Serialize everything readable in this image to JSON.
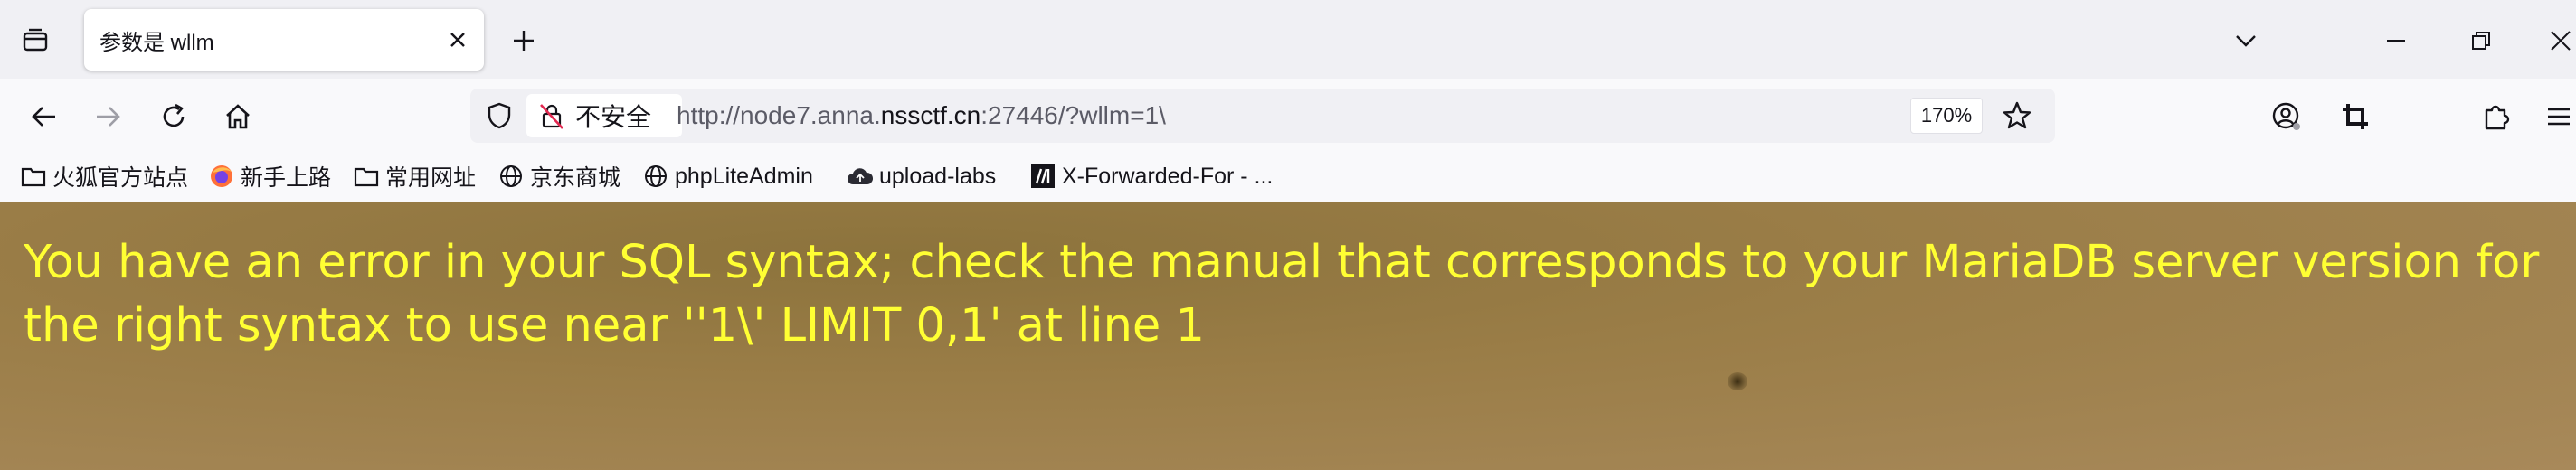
{
  "tab": {
    "title": "参数是 wllm"
  },
  "toolbar": {
    "security_label": "不安全",
    "url_prefix": "http://node7.anna.",
    "url_host": "nssctf.cn",
    "url_suffix": ":27446/?wllm=1\\",
    "zoom": "170%"
  },
  "bookmarks": [
    {
      "label": "火狐官方站点",
      "icon": "folder-icon"
    },
    {
      "label": "新手上路",
      "icon": "firefox-icon"
    },
    {
      "label": "常用网址",
      "icon": "folder-icon"
    },
    {
      "label": "京东商城",
      "icon": "globe-icon"
    },
    {
      "label": "phpLiteAdmin",
      "icon": "globe-icon"
    },
    {
      "label": "upload-labs",
      "icon": "cloud-icon"
    },
    {
      "label": "X-Forwarded-For - ...",
      "icon": "mdn-icon"
    }
  ],
  "page": {
    "error_message": "You have an error in your SQL syntax; check the manual that corresponds to your MariaDB server version for the right syntax to use near ''1\\' LIMIT 0,1' at line 1"
  },
  "colors": {
    "error_text": "#ffff33",
    "page_background": "#9a7d47"
  }
}
